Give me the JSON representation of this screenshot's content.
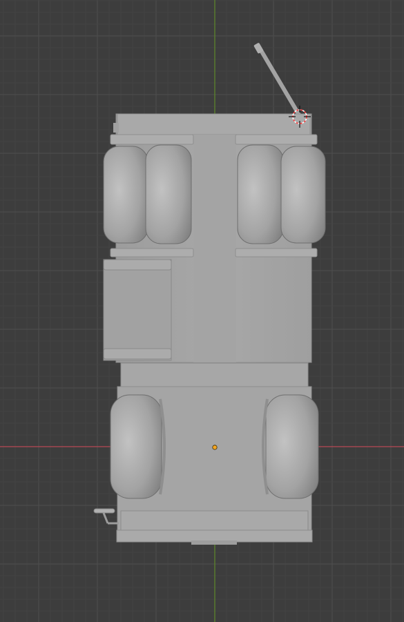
{
  "viewport": {
    "view_mode": "top-orthographic",
    "shading": "solid",
    "background_color": "#3d3d3d",
    "grid_minor_color": "#454545",
    "grid_major_color": "#4f4f4f",
    "x_axis_color": "#b84a55",
    "y_axis_color": "#5f8a2a",
    "model_color": "#a6a6a6",
    "model_shadow_color": "#8a8a8a",
    "model_highlight_color": "#bdbdbd",
    "origin_color": "#f5a623",
    "cursor_ring_color": "#ff4040"
  },
  "objects": [
    {
      "name": "truck",
      "parts": [
        "cab",
        "front-wheel-left",
        "front-wheel-right",
        "fuel-tank",
        "rear-dual-wheels-left",
        "rear-dual-wheels-right",
        "exhaust-pipe",
        "mirror"
      ]
    }
  ],
  "tools": {
    "cursor_3d": "3d-cursor-icon",
    "origin": "object-origin-icon"
  }
}
